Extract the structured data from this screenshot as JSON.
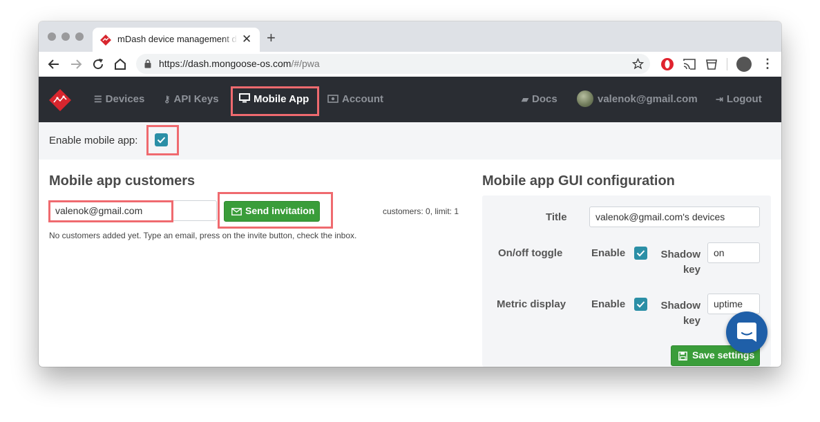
{
  "browser": {
    "tab_title": "mDash device management da",
    "tab_close": "✕",
    "new_tab": "+",
    "url_host": "https://dash.mongoose-os.com",
    "url_path": "/#/pwa"
  },
  "nav": {
    "items": [
      {
        "label": "Devices",
        "icon": "list-icon"
      },
      {
        "label": "API Keys",
        "icon": "key-icon"
      },
      {
        "label": "Mobile App",
        "icon": "monitor-icon"
      },
      {
        "label": "Account",
        "icon": "money-icon"
      }
    ],
    "docs": "Docs",
    "user": "valenok@gmail.com",
    "logout": "Logout",
    "active": "Mobile App"
  },
  "enable": {
    "label": "Enable mobile app:",
    "checked": true
  },
  "customers": {
    "heading": "Mobile app customers",
    "email_value": "valenok@gmail.com",
    "send_button": "Send invitation",
    "count_text": "customers: 0, limit: 1",
    "note": "No customers added yet. Type an email, press on the invite button, check the inbox."
  },
  "gui": {
    "heading": "Mobile app GUI configuration",
    "title_label": "Title",
    "title_value": "valenok@gmail.com's devices",
    "onoff_label": "On/off toggle",
    "onoff_enable": "Enable",
    "onoff_checked": true,
    "onoff_shadow_label_1": "Shadow",
    "onoff_shadow_label_2": "key",
    "onoff_shadow_value": "on",
    "metric_label": "Metric display",
    "metric_enable": "Enable",
    "metric_checked": true,
    "metric_shadow_label_1": "Shadow",
    "metric_shadow_label_2": "key",
    "metric_shadow_value": "uptime",
    "save_button": "Save settings"
  },
  "colors": {
    "nav_bg": "#2a2d33",
    "accent_teal": "#2b8fa6",
    "button_green": "#3a9d3a",
    "highlight": "#ef6a6f",
    "brand_red": "#d8262e",
    "chat_blue": "#1f5fa8"
  }
}
